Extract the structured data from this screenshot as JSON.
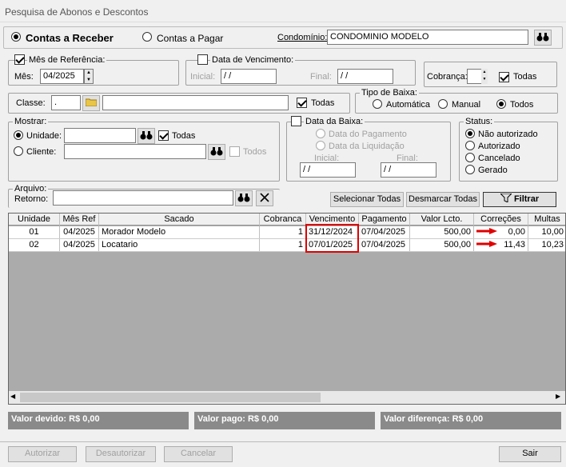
{
  "window": {
    "title": "Pesquisa de Abonos e Descontos"
  },
  "top": {
    "contas_receber": "Contas a Receber",
    "contas_pagar": "Contas a Pagar",
    "condominio_label": "Condomínio:",
    "condominio_value": "CONDOMINIO MODELO"
  },
  "mes_ref": {
    "label": "Mês de Referência:",
    "mes_label": "Mês:",
    "mes_value": "04/2025"
  },
  "data_venc": {
    "label": "Data de Vencimento:",
    "inicial_label": "Inicial:",
    "inicial_value": "/ /",
    "final_label": "Final:",
    "final_value": "/ /"
  },
  "cobranca": {
    "label": "Cobrança:",
    "todas": "Todas"
  },
  "classe": {
    "label": "Classe:",
    "code": ".",
    "todas": "Todas"
  },
  "tipo_baixa": {
    "label": "Tipo de Baixa:",
    "automatica": "Automática",
    "manual": "Manual",
    "todos": "Todos"
  },
  "mostrar": {
    "label": "Mostrar:",
    "unidade": "Unidade:",
    "todas": "Todas",
    "cliente": "Cliente:",
    "todos": "Todos"
  },
  "data_baixa": {
    "label": "Data da Baixa:",
    "pagamento": "Data do Pagamento",
    "liquidacao": "Data da Liquidação",
    "inicial_label": "Inicial:",
    "final_label": "Final:",
    "inicial_value": "/ /",
    "final_value": "/ /"
  },
  "status": {
    "label": "Status:",
    "nao_autorizado": "Não autorizado",
    "autorizado": "Autorizado",
    "cancelado": "Cancelado",
    "gerado": "Gerado"
  },
  "arquivo": {
    "label": "Arquivo:",
    "retorno": "Retorno:"
  },
  "actions": {
    "selecionar": "Selecionar Todas",
    "desmarcar": "Desmarcar Todas",
    "filtrar": "Filtrar"
  },
  "grid": {
    "columns": [
      "Unidade",
      "Mês Ref",
      "Sacado",
      "Cobranca",
      "Vencimento",
      "Pagamento",
      "Valor Lcto.",
      "Correções",
      "Multas"
    ],
    "rows": [
      {
        "unidade": "01",
        "mes": "04/2025",
        "sacado": "Morador Modelo",
        "cobranca": "1",
        "vencimento": "31/12/2024",
        "pagamento": "07/04/2025",
        "valor": "500,00",
        "correcoes": "0,00",
        "multas": "10,00"
      },
      {
        "unidade": "02",
        "mes": "04/2025",
        "sacado": "Locatario",
        "cobranca": "1",
        "vencimento": "07/01/2025",
        "pagamento": "07/04/2025",
        "valor": "500,00",
        "correcoes": "11,43",
        "multas": "10,23"
      }
    ]
  },
  "totals": {
    "devido": "Valor devido: R$ 0,00",
    "pago": "Valor pago: R$ 0,00",
    "diferenca": "Valor diferença: R$ 0,00"
  },
  "bottom": {
    "autorizar": "Autorizar",
    "desautorizar": "Desautorizar",
    "cancelar": "Cancelar",
    "sair": "Sair"
  },
  "colors": {
    "highlight": "#e00000"
  }
}
